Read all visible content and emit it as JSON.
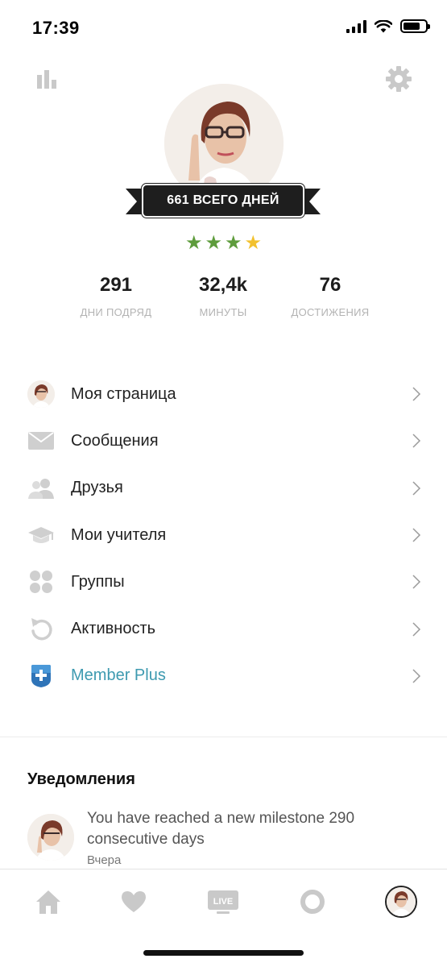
{
  "status_bar": {
    "time": "17:39"
  },
  "profile": {
    "total_days_badge": "661 ВСЕГО ДНЕЙ",
    "stars": {
      "filled_green": 3,
      "gold": 1
    }
  },
  "stats": [
    {
      "value": "291",
      "label": "ДНИ ПОДРЯД"
    },
    {
      "value": "32,4k",
      "label": "МИНУТЫ"
    },
    {
      "value": "76",
      "label": "ДОСТИЖЕНИЯ"
    }
  ],
  "menu": {
    "items": [
      {
        "label": "Моя страница",
        "icon": "avatar"
      },
      {
        "label": "Сообщения",
        "icon": "envelope-icon"
      },
      {
        "label": "Друзья",
        "icon": "friends-icon"
      },
      {
        "label": "Мои учителя",
        "icon": "graduation-cap-icon"
      },
      {
        "label": "Группы",
        "icon": "groups-icon"
      },
      {
        "label": "Активность",
        "icon": "activity-icon"
      },
      {
        "label": "Member Plus",
        "icon": "member-plus-icon"
      }
    ]
  },
  "notifications": {
    "title": "Уведомления",
    "items": [
      {
        "text": "You have reached a new milestone 290 consecutive days",
        "time": "Вчера"
      }
    ]
  },
  "tab_bar": {
    "live_label": "LIVE"
  },
  "colors": {
    "accent_teal": "#3e9ab0",
    "star_green": "#5e9c3c",
    "star_gold": "#f2c12e",
    "icon_gray": "#c4c4c4",
    "ribbon": "#1e1e1e"
  }
}
